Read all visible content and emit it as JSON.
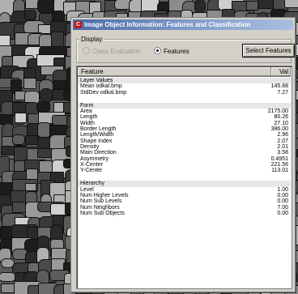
{
  "window": {
    "title": "Image Object Information: Features and Classification",
    "app_icon_glyph": "C"
  },
  "display": {
    "legend": "Display",
    "option_class": "Class Evaluation",
    "option_features": "Features",
    "selected": "Features"
  },
  "toolbar": {
    "select_features_label": "Select Features"
  },
  "table": {
    "col_feature": "Feature",
    "col_value": "Val",
    "groups": [
      {
        "name": "Layer Values",
        "rows": [
          {
            "label": "Mean odkal.bmp",
            "value": "145.68"
          },
          {
            "label": "StdDev odkal.bmp",
            "value": "7.27"
          }
        ]
      },
      {
        "name": "Form",
        "rows": [
          {
            "label": "Area",
            "value": "2175.00"
          },
          {
            "label": "Length",
            "value": "80.26"
          },
          {
            "label": "Width",
            "value": "27.10"
          },
          {
            "label": "Border Length",
            "value": "386.00"
          },
          {
            "label": "Length/Width",
            "value": "2.96"
          },
          {
            "label": "Shape Index",
            "value": "2.07"
          },
          {
            "label": "Density",
            "value": "2.01"
          },
          {
            "label": "Main Direction",
            "value": "3.58"
          },
          {
            "label": "Asymmetry",
            "value": "0.4951"
          },
          {
            "label": "X-Center",
            "value": "221.56"
          },
          {
            "label": "Y-Center",
            "value": "113.01"
          }
        ]
      },
      {
        "name": "Hierarchy",
        "rows": [
          {
            "label": "Level",
            "value": "1.00"
          },
          {
            "label": "Num Higher Levels",
            "value": "0.00"
          },
          {
            "label": "Num Sub Levels",
            "value": "0.00"
          },
          {
            "label": "Num Neighbors",
            "value": "7.00"
          },
          {
            "label": "Num Sub Objects",
            "value": "0.00"
          }
        ]
      }
    ]
  }
}
